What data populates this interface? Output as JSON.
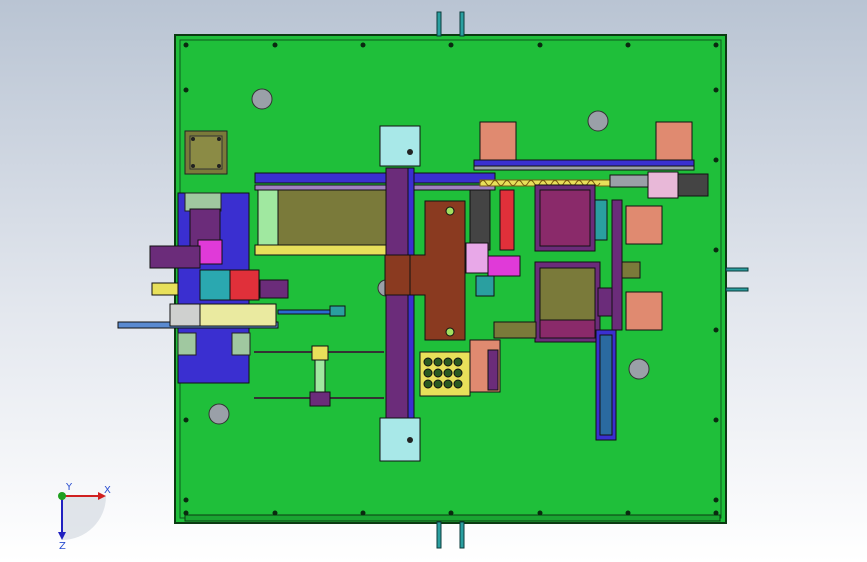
{
  "viewport": {
    "background_top": "#b9c4d3",
    "background_bottom": "#ffffff"
  },
  "model": {
    "plate_color": "#1fbf3a",
    "accent_colors": {
      "blue": "#3a2fd0",
      "purple": "#6b2c7a",
      "magenta": "#e03ad8",
      "olive": "#7a7a3a",
      "brown": "#8a3a20",
      "cyan": "#7be0d8",
      "salmon": "#e08a70",
      "yellow": "#e8e05a",
      "red": "#e0303a"
    },
    "icons": [
      "mounting-hole-icon",
      "bolt-icon",
      "spring-icon"
    ]
  },
  "triad": {
    "x_label": "X",
    "y_label": "Y",
    "z_label": "Z",
    "x_color": "#d02020",
    "y_color": "#20a020",
    "z_color": "#2020c0"
  }
}
